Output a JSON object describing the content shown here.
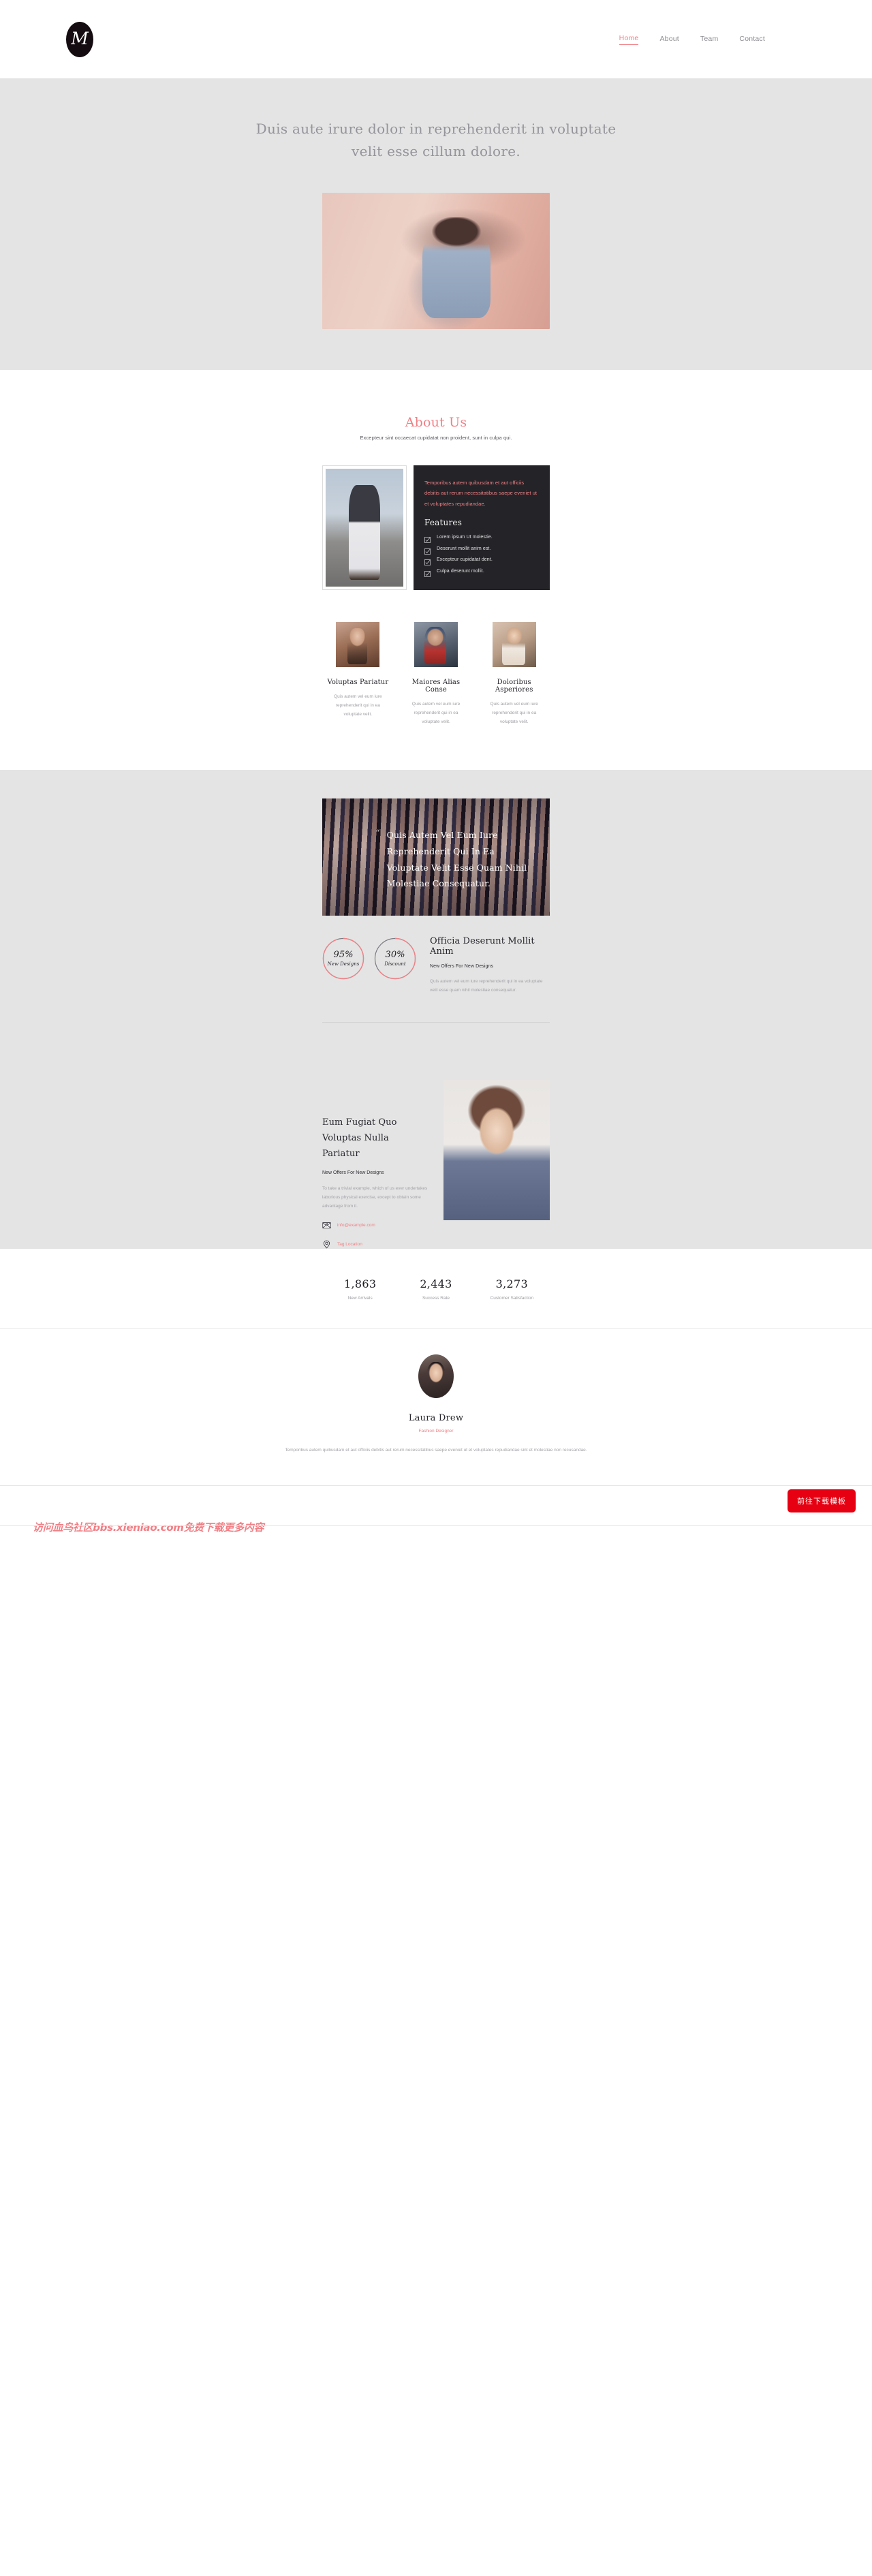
{
  "header": {
    "logo_letter": "M",
    "nav": [
      {
        "label": "Home",
        "active": true
      },
      {
        "label": "About",
        "active": false
      },
      {
        "label": "Team",
        "active": false
      },
      {
        "label": "Contact",
        "active": false
      }
    ]
  },
  "hero": {
    "heading_line1": "Duis aute irure dolor in reprehenderit in voluptate",
    "heading_line2": "velit esse cillum dolore.",
    "image_alt": "woman-in-sunglasses-pink-wall-photo"
  },
  "about": {
    "title": "About Us",
    "subtitle": "Excepteur sint occaecat cupidatat non proident, sunt in culpa qui.",
    "photo_alt": "man-standing-on-bridge-photo",
    "panel_lead": "Temporibus autem quibusdam et aut officiis debitis aut rerum necessitatibus saepe eveniet ut et voluptates repudiandae.",
    "features_title": "Features",
    "features": [
      "Lorem ipsum Ut molestie.",
      "Deserunt mollit anim est.",
      "Excepteur cupidatat dent.",
      "Culpa deserunt mollit."
    ]
  },
  "team": [
    {
      "name": "Voluptas Pariatur",
      "desc": "Quis autem vel eum iure reprehenderit qui in ea voluptate velit.",
      "photo_alt": "woman-long-hair-portrait"
    },
    {
      "name": "Maiores Alias Conse",
      "desc": "Quis autem vel eum iure reprehenderit qui in ea voluptate velit.",
      "photo_alt": "man-with-red-scarf-portrait"
    },
    {
      "name": "Doloribus Asperiores",
      "desc": "Quis autem vel eum iure reprehenderit qui in ea voluptate velit.",
      "photo_alt": "woman-blonde-portrait"
    }
  ],
  "quote": {
    "mark": "“",
    "text": "Quis Autem Vel Eum Iure Reprehenderit Qui In Ea Voluptate Velit Esse Quam Nihil Molestiae Consequatur.",
    "image_alt": "clothing-rack-boutique-photo"
  },
  "offers": {
    "rings": [
      {
        "value": "95%",
        "caption": "New Designs",
        "percent": 95
      },
      {
        "value": "30%",
        "caption": "Discount",
        "percent": 30
      }
    ],
    "title": "Officia Deserunt Mollit Anim",
    "subtitle": "New Offers For New Designs",
    "body": "Quis autem vel eum iure reprehenderit qui in ea voluptate velit esse quam nihil molestiae consequatur."
  },
  "contact": {
    "title": "Eum Fugiat Quo Voluptas Nulla Pariatur",
    "subtitle": "New Offers For New Designs",
    "body": "To take a trivial example, which of us ever undertakes laborious physical exercise, except to obtain some advantage from it.",
    "email_icon": "envelope-at-icon",
    "email": "info@example.com",
    "location_icon": "map-pin-icon",
    "location": "Tag Location",
    "image_alt": "surprised-woman-white-shirt-photo"
  },
  "counters": [
    {
      "value": "1,863",
      "caption": "New Arrivals"
    },
    {
      "value": "2,443",
      "caption": "Success Rate"
    },
    {
      "value": "3,273",
      "caption": "Customer Satisfaction"
    }
  ],
  "testimonial": {
    "avatar_alt": "laura-drew-avatar",
    "name": "Laura Drew",
    "role": "Fashion Designer",
    "quote": "Temporibus autem quibusdam et aut officiis debitis aut rerum necessitatibus saepe eveniet ut et voluptates repudiandae sint et molestiae non recusandae."
  },
  "footer": {
    "watermark": "访问血鸟社区bbs.xieniao.com免费下载更多内容",
    "download_button": "前往下载模板"
  },
  "colors": {
    "accent": "#ef8186",
    "dark_panel": "#242327",
    "hero_bg": "#e4e4e4",
    "button_red": "#e60012",
    "ring_track": "#7b7b82"
  }
}
